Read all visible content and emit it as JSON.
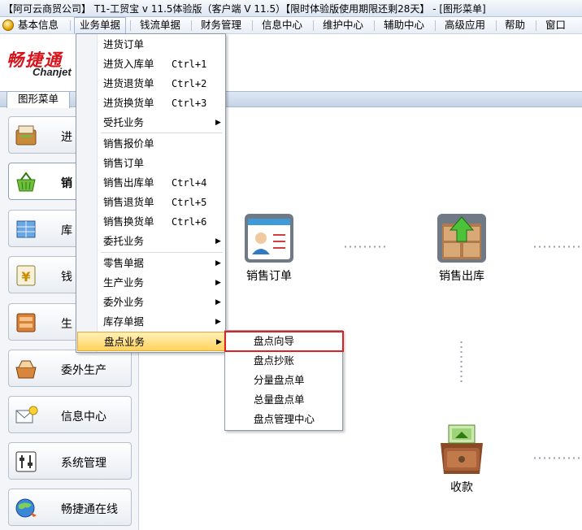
{
  "window": {
    "title": "【阿可云商贸公司】 T1-工贸宝 v 11.5体验版（客户端 V 11.5）【限时体验版使用期限还剩28天】 - [图形菜单]"
  },
  "menubar": {
    "items": [
      "基本信息",
      "业务单据",
      "钱流单据",
      "财务管理",
      "信息中心",
      "维护中心",
      "辅助中心",
      "高级应用",
      "帮助",
      "窗口"
    ],
    "active_index": 1
  },
  "logo": {
    "cn": "畅捷通",
    "en": "Chanjet"
  },
  "tabs": {
    "graphic_menu": "图形菜单"
  },
  "sidebar": {
    "items": [
      {
        "label": "进",
        "icon": "purchase-icon"
      },
      {
        "label": "销",
        "icon": "sales-basket-icon"
      },
      {
        "label": "库",
        "icon": "inventory-icon"
      },
      {
        "label": "钱",
        "icon": "money-icon"
      },
      {
        "label": "生",
        "icon": "production-icon"
      },
      {
        "label": "委外生产",
        "icon": "outsourcing-icon"
      },
      {
        "label": "信息中心",
        "icon": "info-center-icon"
      },
      {
        "label": "系统管理",
        "icon": "system-settings-icon"
      },
      {
        "label": "畅捷通在线",
        "icon": "online-globe-icon"
      }
    ],
    "selected_index": 1
  },
  "canvas": {
    "nodes": [
      {
        "label": "销售订单",
        "icon": "sales-order-icon"
      },
      {
        "label": "销售出库",
        "icon": "sales-outbound-icon"
      },
      {
        "label": "收款",
        "icon": "receipt-cash-icon"
      }
    ]
  },
  "menu_business": {
    "items": [
      {
        "label": "进货订单",
        "shortcut": "",
        "submenu": false
      },
      {
        "label": "进货入库单",
        "shortcut": "Ctrl+1",
        "submenu": false
      },
      {
        "label": "进货退货单",
        "shortcut": "Ctrl+2",
        "submenu": false
      },
      {
        "label": "进货换货单",
        "shortcut": "Ctrl+3",
        "submenu": false
      },
      {
        "label": "受托业务",
        "shortcut": "",
        "submenu": true
      },
      {
        "label": "销售报价单",
        "shortcut": "",
        "submenu": false
      },
      {
        "label": "销售订单",
        "shortcut": "",
        "submenu": false
      },
      {
        "label": "销售出库单",
        "shortcut": "Ctrl+4",
        "submenu": false
      },
      {
        "label": "销售退货单",
        "shortcut": "Ctrl+5",
        "submenu": false
      },
      {
        "label": "销售换货单",
        "shortcut": "Ctrl+6",
        "submenu": false
      },
      {
        "label": "委托业务",
        "shortcut": "",
        "submenu": true
      },
      {
        "label": "零售单据",
        "shortcut": "",
        "submenu": true
      },
      {
        "label": "生产业务",
        "shortcut": "",
        "submenu": true
      },
      {
        "label": "委外业务",
        "shortcut": "",
        "submenu": true
      },
      {
        "label": "库存单据",
        "shortcut": "",
        "submenu": true
      },
      {
        "label": "盘点业务",
        "shortcut": "",
        "submenu": true
      }
    ],
    "highlighted_index": 15,
    "arrow": "▶"
  },
  "menu_stocktake": {
    "items": [
      "盘点向导",
      "盘点抄账",
      "分量盘点单",
      "总量盘点单",
      "盘点管理中心"
    ],
    "boxed_index": 0
  },
  "colors": {
    "logo_red": "#d6141c",
    "highlight_box": "#e02020",
    "menu_highlight": "#ffd25e"
  }
}
